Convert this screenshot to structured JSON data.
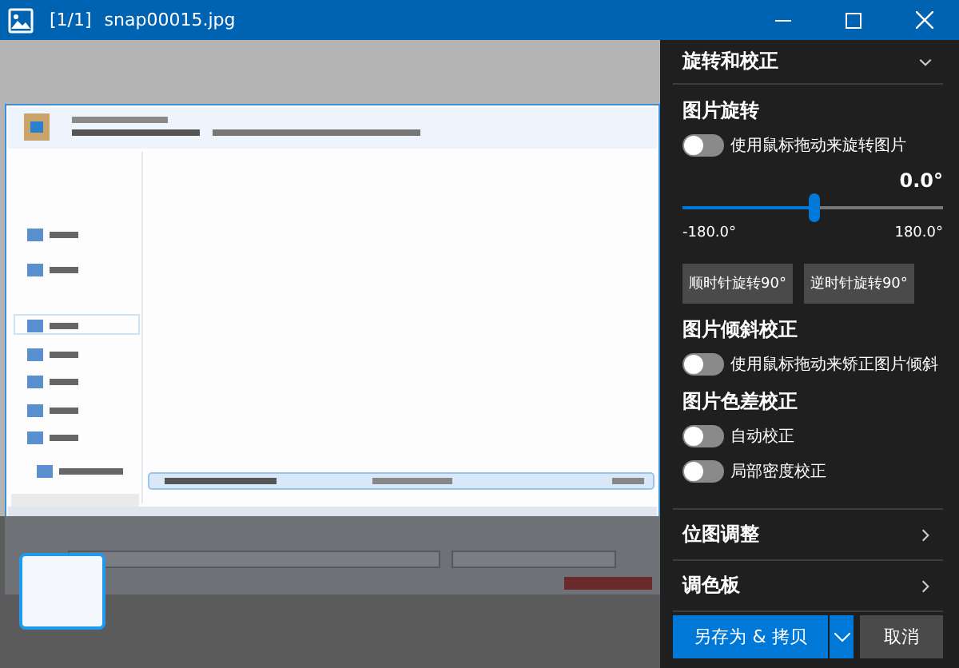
{
  "window": {
    "counter": "[1/1]",
    "title": "snap00015.jpg"
  },
  "filmstrip": {
    "thumbnails": [
      {
        "selected": true
      }
    ]
  },
  "panel": {
    "section": {
      "title": "旋转和校正",
      "expanded": true
    },
    "groups": [
      {
        "heading": "图片旋转",
        "rows": [
          {
            "kind": "toggle",
            "label": "使用鼠标拖动来旋转图片",
            "on": false
          },
          {
            "kind": "slider",
            "reading": "0.0°",
            "level": 0.5,
            "min_label": "-180.0°",
            "max_label": "180.0°"
          },
          {
            "kind": "buttons",
            "buttons": [
              "顺时针旋转90°",
              "逆时针旋转90°"
            ]
          }
        ]
      },
      {
        "heading": "图片倾斜校正",
        "rows": [
          {
            "kind": "toggle",
            "label": "使用鼠标拖动来矫正图片倾斜",
            "on": false
          }
        ]
      },
      {
        "heading": "图片色差校正",
        "rows": [
          {
            "kind": "toggle",
            "label": "自动校正",
            "on": false
          },
          {
            "kind": "toggle",
            "label": "局部密度校正",
            "on": false
          }
        ]
      }
    ],
    "collapsed_sections": [
      {
        "title": "位图调整",
        "expanded": false
      },
      {
        "title": "调色板",
        "expanded": false
      }
    ],
    "save_button": "另存为 & 拷贝",
    "cancel_button": "取消"
  }
}
